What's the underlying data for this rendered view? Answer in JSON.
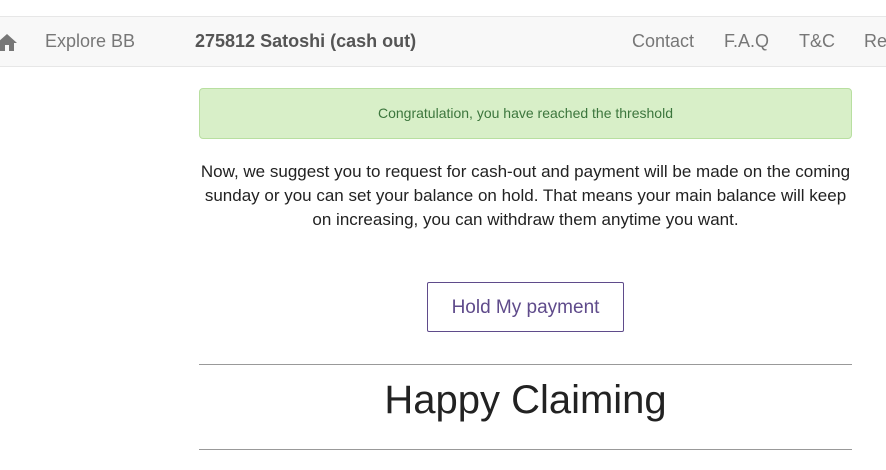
{
  "nav": {
    "home_icon": "home-icon",
    "explore": "Explore BB",
    "balance": "275812 Satoshi (cash out)",
    "contact": "Contact",
    "faq": "F.A.Q",
    "tc": "T&C",
    "truncated": "Re"
  },
  "alert": {
    "text": "Congratulation, you have reached the threshold"
  },
  "message": "Now, we suggest you to request for cash-out and payment will be made on the coming sunday or you can set your balance on hold. That means your main balance will keep on increasing, you can withdraw them anytime you want.",
  "hold_button": "Hold My payment",
  "heading": "Happy Claiming",
  "colors": {
    "navbar_bg": "#f8f8f8",
    "alert_bg": "#d8efc8",
    "alert_text": "#3c763d",
    "button_accent": "#5f4b8b"
  }
}
